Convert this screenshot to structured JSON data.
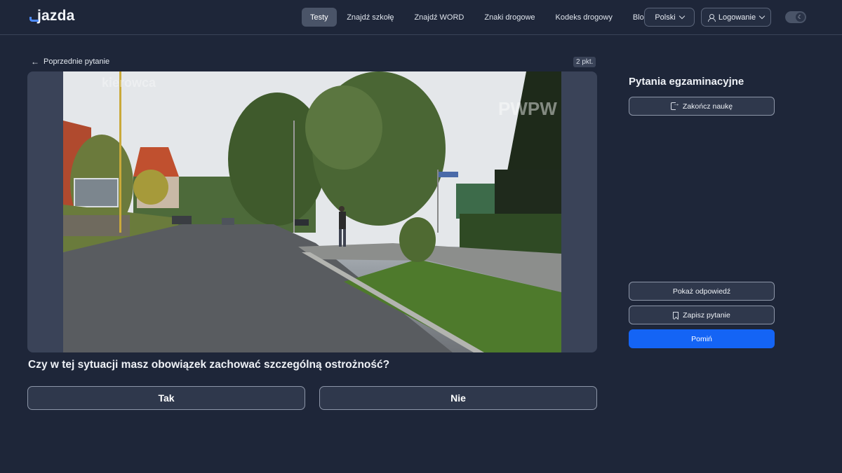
{
  "header": {
    "logo": "jazda",
    "nav": [
      {
        "label": "Testy",
        "active": true
      },
      {
        "label": "Znajdź szkołę",
        "active": false
      },
      {
        "label": "Znajdź WORD",
        "active": false
      },
      {
        "label": "Znaki drogowe",
        "active": false
      },
      {
        "label": "Kodeks drogowy",
        "active": false
      },
      {
        "label": "Blog",
        "active": false
      }
    ],
    "language": "Polski",
    "login": "Logowanie",
    "theme_icon": "moon-icon"
  },
  "question": {
    "prev_label": "Poprzednie pytanie",
    "points": "2 pkt.",
    "text": "Czy w tej sytuacji masz obowiązek zachować szczególną ostrożność?",
    "answers": [
      "Tak",
      "Nie"
    ],
    "watermarks": [
      "kierowca",
      "PWPW"
    ]
  },
  "sidebar": {
    "title": "Pytania egzaminacyjne",
    "finish_label": "Zakończ naukę",
    "show_answer_label": "Pokaż odpowiedź",
    "save_label": "Zapisz pytanie",
    "skip_label": "Pomiń"
  },
  "colors": {
    "background": "#1e2639",
    "accent": "#1464f5"
  }
}
